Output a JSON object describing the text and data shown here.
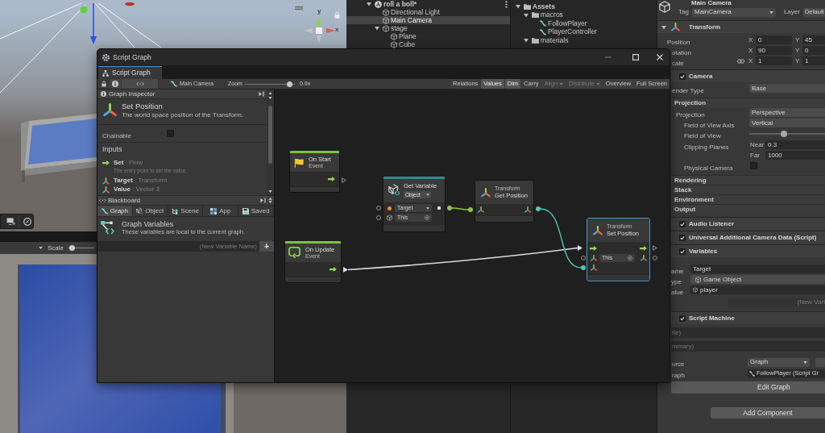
{
  "scene": {
    "axes": [
      {
        "label": "y"
      },
      {
        "label": "x"
      }
    ]
  },
  "game": {
    "scale_label": "Scale",
    "scale": {
      "level": 0.05
    }
  },
  "hierarchy": {
    "items": [
      {
        "kind": "scene",
        "label": "roll a boll*",
        "selected": false,
        "expanded": true,
        "children": [
          {
            "kind": "object",
            "label": "Directional Light",
            "selected": false
          },
          {
            "kind": "object",
            "label": "Main Camera",
            "selected": true
          },
          {
            "kind": "object",
            "label": "stage",
            "selected": false,
            "expanded": true,
            "children": [
              {
                "kind": "object",
                "label": "Plane",
                "selected": false
              },
              {
                "kind": "object",
                "label": "Cube",
                "selected": false
              }
            ]
          }
        ]
      }
    ]
  },
  "project": {
    "items": [
      {
        "kind": "folder",
        "label": "Assets",
        "selected": false,
        "expanded": true,
        "children": [
          {
            "kind": "folder",
            "label": "macros",
            "selected": false,
            "expanded": true,
            "children": [
              {
                "kind": "graph",
                "label": "FollowPlayer",
                "selected": false
              },
              {
                "kind": "graph",
                "label": "PlayerController",
                "selected": false
              }
            ]
          },
          {
            "kind": "folder",
            "label": "materials",
            "selected": false,
            "expanded": true
          }
        ]
      }
    ]
  },
  "inspector": {
    "name": "Main Camera",
    "tag_label": "Tag",
    "tag": "MainCamera",
    "layer_label": "Layer",
    "layer": "Default",
    "rows": [
      {
        "kind": "foldout",
        "title": "Transform",
        "expanded": true
      },
      {
        "kind": "vector",
        "label": "Position",
        "fields": [
          {
            "axis": "X",
            "value": "0"
          },
          {
            "axis": "Y",
            "value": "45"
          }
        ]
      },
      {
        "kind": "vector",
        "label": "otation",
        "fields": [
          {
            "axis": "X",
            "value": "90"
          },
          {
            "axis": "Y",
            "value": "0"
          }
        ]
      },
      {
        "kind": "vector",
        "label": "cale",
        "constrained": true,
        "fields": [
          {
            "axis": "X",
            "value": "1"
          },
          {
            "axis": "Y",
            "value": "1"
          }
        ]
      },
      {
        "kind": "component",
        "title": "Camera",
        "enabled": true
      },
      {
        "kind": "dropdown",
        "label": "ender Type",
        "value": "Base"
      },
      {
        "kind": "section",
        "title": "Projection",
        "children": [
          {
            "kind": "dropdown",
            "label": "Projection",
            "value": "Perspective",
            "children": [
              {
                "kind": "dropdown",
                "label": "Field of View Axis",
                "value": "Vertical"
              },
              {
                "kind": "slider",
                "label": "Field of View",
                "level": 0.46
              },
              {
                "kind": "planes",
                "label": "Clipping Planes",
                "fields": [
                  {
                    "label": "Near",
                    "value": "0.3"
                  },
                  {
                    "label": "Far",
                    "value": "1000"
                  }
                ]
              },
              {
                "kind": "checkbox",
                "label": "Physical Camera",
                "checked": false
              }
            ]
          }
        ]
      },
      {
        "kind": "section",
        "title": "Rendering"
      },
      {
        "kind": "section",
        "title": "Stack"
      },
      {
        "kind": "section",
        "title": "Environment"
      },
      {
        "kind": "section",
        "title": "Output"
      },
      {
        "kind": "component",
        "title": "Audio Listener",
        "enabled": true
      },
      {
        "kind": "component",
        "title": "Universal Additional Camera Data (Script)",
        "enabled": true
      },
      {
        "kind": "component",
        "title": "Variables",
        "enabled": true
      },
      {
        "kind": "textfield",
        "label": "ame",
        "value": "Target"
      },
      {
        "kind": "typefield",
        "label": "ype",
        "value": "Game Object"
      },
      {
        "kind": "reffield",
        "label": "alue",
        "value": "player"
      },
      {
        "kind": "newvariable",
        "placeholder": "(New Vari"
      },
      {
        "kind": "component",
        "title": "Script Machine",
        "enabled": true
      },
      {
        "kind": "hintfield",
        "placeholder": "tle)"
      },
      {
        "kind": "hintfield",
        "placeholder": "mmary)"
      },
      {
        "kind": "picker",
        "label": "urce",
        "value": "Graph"
      },
      {
        "kind": "assetfield",
        "label": "raph",
        "value": "FollowPlayer (Script Gr"
      },
      {
        "kind": "button",
        "label": "Edit Graph"
      },
      {
        "kind": "addbutton",
        "label": "Add Component"
      }
    ]
  },
  "script_graph": {
    "title": "Script Graph",
    "tabs": [
      {
        "label": "Script Graph",
        "selected": true
      }
    ],
    "toolbar": {
      "target": "Main Camera",
      "zoom_label": "Zoom",
      "zoom": {
        "level": 0.9
      },
      "zoom_reading": "0.9x",
      "items": [
        {
          "kind": "toggle",
          "label": "Relations",
          "on": false,
          "disabled": false
        },
        {
          "kind": "toggle",
          "label": "Values",
          "on": true,
          "disabled": false
        },
        {
          "kind": "toggle",
          "label": "Dim",
          "on": true,
          "disabled": false
        },
        {
          "kind": "toggle",
          "label": "Carry",
          "on": false,
          "disabled": false
        },
        {
          "kind": "menu",
          "label": "Align",
          "disabled": true
        },
        {
          "kind": "menu",
          "label": "Distribute",
          "disabled": true
        },
        {
          "kind": "button",
          "label": "Overview",
          "disabled": false
        },
        {
          "kind": "button",
          "label": "Full Screen",
          "disabled": false
        }
      ]
    },
    "inspector": {
      "title": "Graph Inspector",
      "node_title": "Set Position",
      "node_summary": "The world space position of the Transform.",
      "chainable_label": "Chainable",
      "chainable": false,
      "inputs_title": "Inputs",
      "inputs": [
        {
          "kind": "flow",
          "label": "**Set** : Flow",
          "description": "The entry point to set the value."
        },
        {
          "kind": "value",
          "label": "**Target** : Transform"
        },
        {
          "kind": "value",
          "label": "**Value** : Vector 3"
        }
      ]
    },
    "blackboard": {
      "title": "Blackboard",
      "tabs": [
        {
          "kind": "graph",
          "label": "Graph",
          "selected": true
        },
        {
          "kind": "object",
          "label": "Object",
          "selected": false
        },
        {
          "kind": "scene",
          "label": "Scene",
          "selected": false
        },
        {
          "kind": "app",
          "label": "App",
          "selected": false
        },
        {
          "kind": "saved",
          "label": "Saved",
          "selected": false
        }
      ],
      "heading": "Graph Variables",
      "description": "These variables are local to the current graph.",
      "new_variable_placeholder": "(New Variable Name)",
      "add_label": "+"
    },
    "nodes": [
      {
        "kind": "start",
        "title": "On Start",
        "subtitle": "Event",
        "color": "#7cc142",
        "selected": false,
        "flow_out_connected": false
      },
      {
        "kind": "update",
        "title": "On Update",
        "subtitle": "Event",
        "color": "#7cc142",
        "selected": false,
        "flow_out_connected": true
      },
      {
        "kind": "variable",
        "title": "Get Variable",
        "scope": "Object",
        "color": "#2e8c8c",
        "selected": false,
        "name": "Target",
        "target": "This",
        "inputs_connected": false,
        "output_connected": true
      },
      {
        "kind": "getter",
        "category": "Transform",
        "title": "Get Position",
        "selected": false,
        "input_connected": true,
        "output_connected": true
      },
      {
        "kind": "setter",
        "category": "Transform",
        "title": "Set Position",
        "selected": true,
        "target": "This",
        "flow_in_connected": true,
        "flow_out_connected": false,
        "target_connected": false,
        "value_connected": true,
        "output_connected": false
      }
    ]
  }
}
